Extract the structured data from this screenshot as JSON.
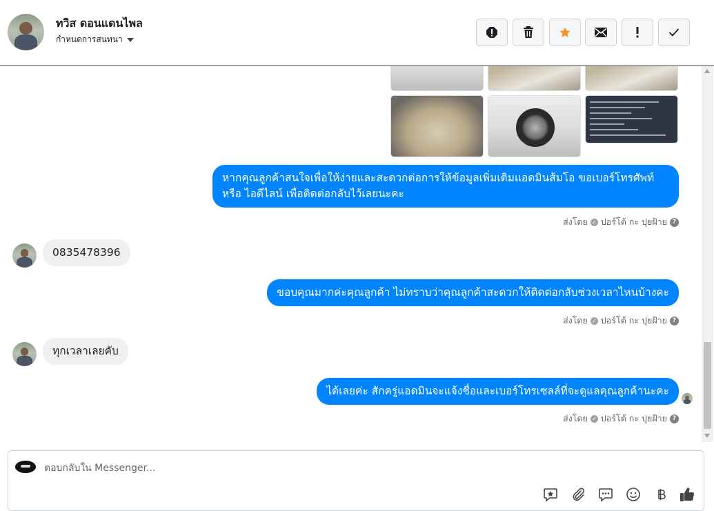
{
  "header": {
    "contact_name": "ทวิส ดอนแดนไพล",
    "assign_label": "กำหนดการสนทนา",
    "actions": [
      "mark-spam-icon",
      "delete-icon",
      "star-icon",
      "mark-unread-icon",
      "important-icon",
      "done-icon"
    ],
    "star_color": "#f7931e"
  },
  "messages": [
    {
      "type": "outgoing",
      "text": "หากคุณลูกค้าสนใจเพื่อให้ง่ายและสะดวกต่อการให้ข้อมูลเพิ่มเติมแอดมินส้มโอ ขอเบอร์โทรศัพท์ หรือ ไอดีไลน์ เพื่อติดต่อกลับไว้เลยนะคะ"
    },
    {
      "type": "sent_by",
      "label": "ส่งโดย",
      "agent": "ปอร์โต้ กะ ปุยฝ้าย"
    },
    {
      "type": "incoming",
      "text": "0835478396"
    },
    {
      "type": "outgoing",
      "text": "ขอบคุณมากค่ะคุณลูกค้า ไม่ทราบว่าคุณลูกค้าสะดวกให้ติดต่อกลับช่วงเวลาไหนบ้างคะ"
    },
    {
      "type": "sent_by",
      "label": "ส่งโดย",
      "agent": "ปอร์โต้ กะ ปุยฝ้าย"
    },
    {
      "type": "incoming",
      "text": "ทุกเวลาเลยคับ"
    },
    {
      "type": "outgoing",
      "text": "ได้เลยค่ะ สักครู่แอดมินจะแจ้งชื่อและเบอร์โทรเซลล์ที่จะดูแลคุณลูกค้านะคะ"
    },
    {
      "type": "sent_by",
      "label": "ส่งโดย",
      "agent": "ปอร์โต้ กะ ปุยฝ้าย"
    }
  ],
  "composer": {
    "placeholder": "ตอบกลับใน Messenger...",
    "tools": [
      "saved-reply-icon",
      "attach-icon",
      "chat-bubble-icon",
      "emoji-icon",
      "baht-icon",
      "like-icon"
    ]
  },
  "colors": {
    "outgoing_bubble": "#0084ff",
    "incoming_bubble": "#f0f0f0"
  }
}
